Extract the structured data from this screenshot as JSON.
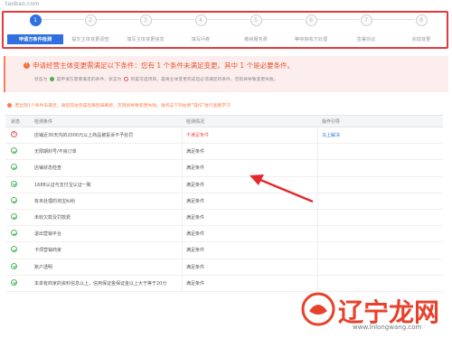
{
  "site_tag": "taobao.com",
  "stepper": {
    "steps": [
      {
        "num": "1",
        "label": "申请方条件检测",
        "active": true
      },
      {
        "num": "2",
        "label": "提交主体变更调查"
      },
      {
        "num": "3",
        "label": "填写主体变更信息"
      },
      {
        "num": "4",
        "label": "填写问卷"
      },
      {
        "num": "5",
        "label": "缴纳服务费"
      },
      {
        "num": "6",
        "label": "等待接收方处理"
      },
      {
        "num": "7",
        "label": "签署协议"
      },
      {
        "num": "8",
        "label": "完成变更"
      }
    ]
  },
  "alert": {
    "title": "申请经营主体变更需满足以下条件：您有 1 个条件未满足变更。其中 1 个是必要条件。",
    "sub_prefix": "状态为",
    "sub_mid": "是申请方需要满足的条件，状态为",
    "sub_suffix": "的是可选项目，是将主体变更完成后必须满足的条件，否则将导致变更失败。"
  },
  "tip": "若出现1个条件未满足，请您前往完成后再回来刷新，否则将导致变更失败。请点击下列右侧“操作”进行查看学习",
  "table": {
    "headers": [
      "状态",
      "检测条件",
      "检测情况",
      "操作引导"
    ],
    "rows": [
      {
        "status": "bad",
        "condition": "店铺近30天内的2000元以上商品被投诉不予处罚",
        "result": "不满足条件",
        "action": "马上解决"
      },
      {
        "status": "ok",
        "condition": "无限期封号/不良订单",
        "result": "满足条件",
        "action": ""
      },
      {
        "status": "ok",
        "condition": "店铺状态检查",
        "result": "满足条件",
        "action": ""
      },
      {
        "status": "ok",
        "condition": "1688认证与支付宝认证一致",
        "result": "满足条件",
        "action": ""
      },
      {
        "status": "ok",
        "condition": "有未处理的淘宝纠纷",
        "result": "满足条件",
        "action": ""
      },
      {
        "status": "ok",
        "condition": "未收欠款及罚款费",
        "result": "满足条件",
        "action": ""
      },
      {
        "status": "ok",
        "condition": "退出营销平台",
        "result": "满足条件",
        "action": ""
      },
      {
        "status": "ok",
        "condition": "卡项营销商家",
        "result": "满足条件",
        "action": ""
      },
      {
        "status": "ok",
        "condition": "账户透明",
        "result": "满足条件",
        "action": ""
      },
      {
        "status": "ok",
        "condition": "本单有商家的资料信息以上，信用保证金保证金以上大于等于20分",
        "result": "满足条件",
        "action": ""
      }
    ]
  },
  "watermark": {
    "text": "辽宁龙网",
    "url": "www.lnlongwang.com"
  }
}
